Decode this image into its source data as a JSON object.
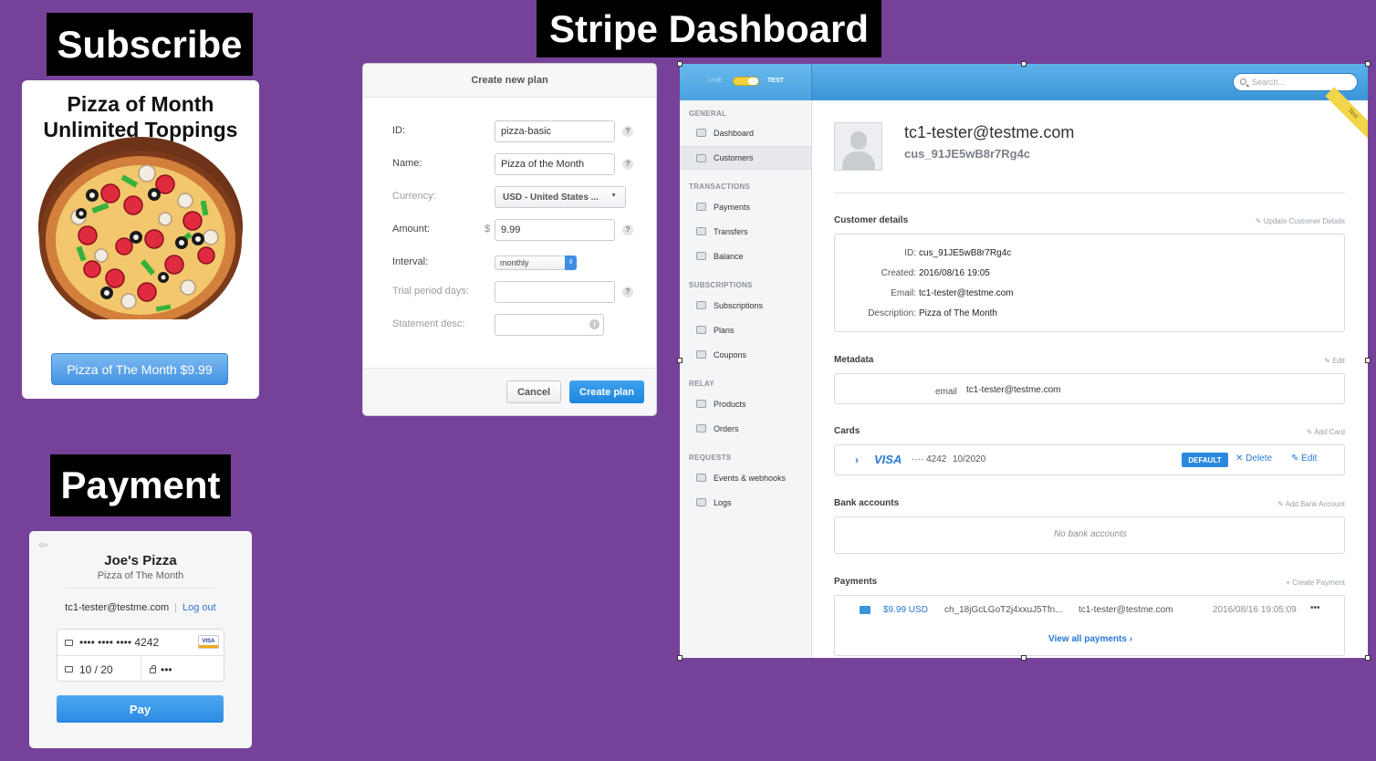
{
  "labels": {
    "subscribe": "Subscribe",
    "dashboard": "Stripe Dashboard",
    "payment": "Payment"
  },
  "subscribe_card": {
    "title_line1": "Pizza of Month",
    "title_line2": "Unlimited Toppings",
    "button_label": "Pizza of The Month $9.99"
  },
  "plan_dialog": {
    "title": "Create new plan",
    "fields": {
      "id_label": "ID:",
      "id_value": "pizza-basic",
      "name_label": "Name:",
      "name_value": "Pizza of the Month",
      "currency_label": "Currency:",
      "currency_value": "USD - United States ...",
      "amount_label": "Amount:",
      "amount_symbol": "$",
      "amount_value": "9.99",
      "interval_label": "Interval:",
      "interval_value": "monthly",
      "trial_label": "Trial period days:",
      "statement_label": "Statement desc:"
    },
    "help_glyph": "?",
    "info_glyph": "i",
    "cancel_label": "Cancel",
    "create_label": "Create plan"
  },
  "checkout": {
    "merchant": "Joe's Pizza",
    "description": "Pizza of The Month",
    "email": "tc1-tester@testme.com",
    "logout_label": "Log out",
    "card_number": "•••• •••• •••• 4242",
    "card_brand": "VISA",
    "expiry": "10 / 20",
    "cvc": "•••",
    "pay_label": "Pay"
  },
  "dashboard": {
    "live_label": "LIVE",
    "test_label": "TEST",
    "search_placeholder": "Search...",
    "test_ribbon": "Test",
    "sidebar": {
      "general": "GENERAL",
      "dashboard": "Dashboard",
      "customers": "Customers",
      "transactions": "TRANSACTIONS",
      "payments": "Payments",
      "transfers": "Transfers",
      "balance": "Balance",
      "subscriptions_section": "SUBSCRIPTIONS",
      "subscriptions": "Subscriptions",
      "plans": "Plans",
      "coupons": "Coupons",
      "relay": "RELAY",
      "products": "Products",
      "orders": "Orders",
      "requests": "REQUESTS",
      "events": "Events & webhooks",
      "logs": "Logs"
    },
    "customer": {
      "email": "tc1-tester@testme.com",
      "id": "cus_91JE5wB8r7Rg4c"
    },
    "details": {
      "title": "Customer details",
      "action": "Update Customer Details",
      "id_key": "ID:",
      "id_val": "cus_91JE5wB8r7Rg4c",
      "created_key": "Created:",
      "created_val": "2016/08/16 19:05",
      "email_key": "Email:",
      "email_val": "tc1-tester@testme.com",
      "desc_key": "Description:",
      "desc_val": "Pizza of The Month"
    },
    "metadata": {
      "title": "Metadata",
      "action": "Edit",
      "key": "email",
      "value": "tc1-tester@testme.com"
    },
    "cards": {
      "title": "Cards",
      "action": "Add Card",
      "brand": "VISA",
      "last4": "···· 4242",
      "expiry": "10/2020",
      "default_badge": "DEFAULT",
      "delete_label": "✕ Delete",
      "edit_label": "✎ Edit"
    },
    "bank": {
      "title": "Bank accounts",
      "action": "Add Bank Account",
      "empty": "No bank accounts"
    },
    "payments": {
      "title": "Payments",
      "action": "Create Payment",
      "amount": "$9.99 USD",
      "charge_id": "ch_18jGcLGoT2j4xxuJ5Tfn...",
      "customer": "tc1-tester@testme.com",
      "date": "2016/08/16 19:05:09",
      "more": "•••",
      "view_all": "View all payments  ›"
    }
  }
}
